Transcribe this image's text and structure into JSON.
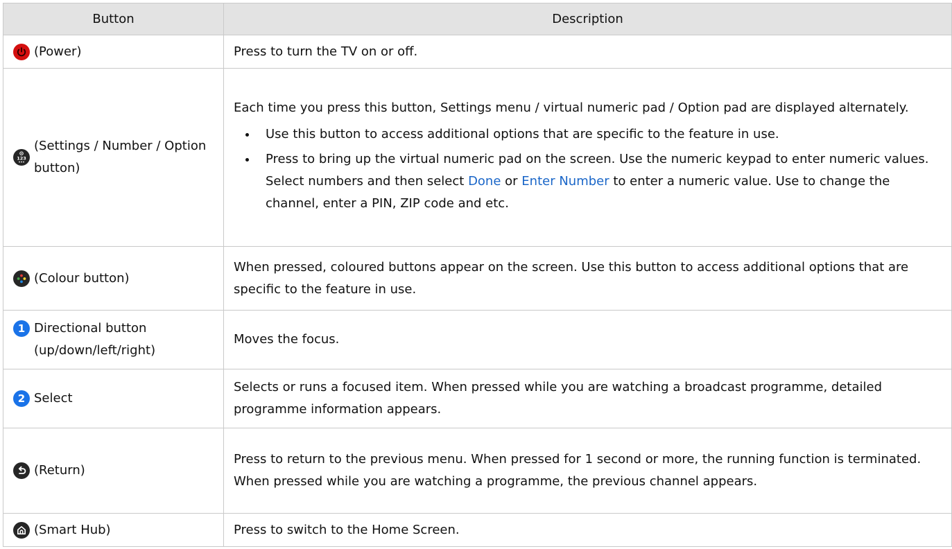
{
  "table": {
    "headers": {
      "button": "Button",
      "description": "Description"
    },
    "colors": {
      "power_red": "#d40f0f",
      "icon_dark": "#262626",
      "accent_blue": "#1a73e8",
      "header_bg": "#e3e3e3"
    },
    "rows": [
      {
        "icon": "power-icon",
        "label": "(Power)",
        "desc": "Press to turn the TV on or off."
      },
      {
        "icon": "settings-number-option-icon",
        "label": "(Settings / Number / Option button)",
        "desc": "Each time you press this button, Settings menu / virtual numeric pad / Option pad are displayed alternately.",
        "bullets": {
          "b1": "Use this button to access additional options that are specific to the feature in use.",
          "b2_pre": "Press to bring up the virtual numeric pad on the screen. Use the numeric keypad to enter numeric values. Select numbers and then select ",
          "b2_done": "Done",
          "b2_or": " or ",
          "b2_enter": "Enter Number",
          "b2_post": " to enter a numeric value. Use to change the channel, enter a PIN, ZIP code and etc."
        }
      },
      {
        "icon": "colour-icon",
        "label": "(Colour button)",
        "desc": "When pressed, coloured buttons appear on the screen. Use this button to access additional options that are specific to the feature in use."
      },
      {
        "badge": "1",
        "label": "Directional button (up/down/left/right)",
        "desc": "Moves the focus."
      },
      {
        "badge": "2",
        "label": "Select",
        "desc": "Selects or runs a focused item. When pressed while you are watching a broadcast programme, detailed programme information appears."
      },
      {
        "icon": "return-icon",
        "label": "(Return)",
        "desc": "Press to return to the previous menu. When pressed for 1 second or more, the running function is terminated. When pressed while you are watching a programme, the previous channel appears."
      },
      {
        "icon": "home-icon",
        "label": "(Smart Hub)",
        "desc": "Press to switch to the Home Screen."
      }
    ]
  }
}
